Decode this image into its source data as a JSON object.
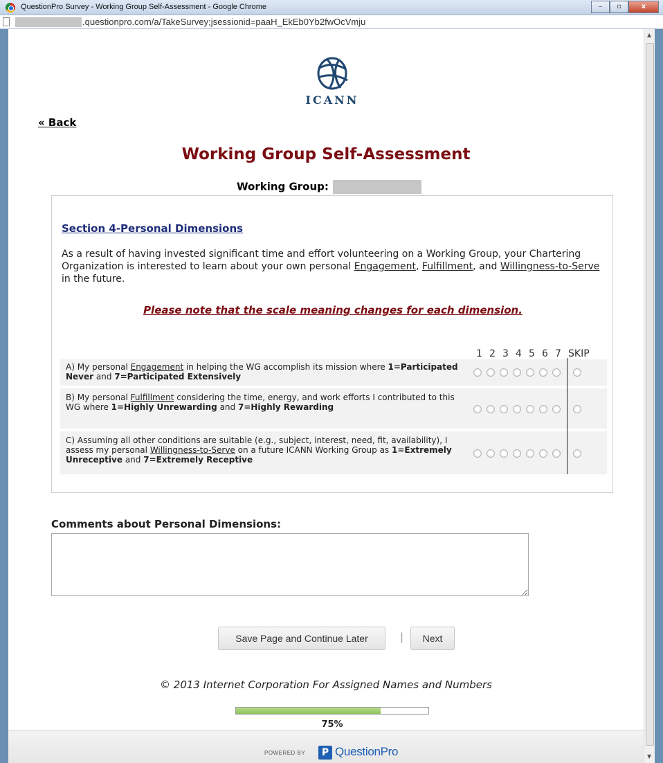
{
  "window": {
    "title": "QuestionPro Survey - Working Group Self-Assessment - Google Chrome",
    "url": ".questionpro.com/a/TakeSurvey;jsessionid=paaH_EkEb0Yb2fwOcVmju",
    "controls": {
      "minimize": "–",
      "maximize": "▫",
      "close": "x"
    }
  },
  "header": {
    "logo_text": "ICANN",
    "back_label": "« Back",
    "page_title": "Working Group Self-Assessment",
    "working_group_label": "Working Group:"
  },
  "section": {
    "title": "Section 4-Personal Dimensions",
    "intro": {
      "part1": "As a result of having invested significant time and effort volunteering on a Working Group, your Chartering Organization is interested to learn about your own personal ",
      "term1": "Engagement",
      "sep1": ", ",
      "term2": "Fulfillment",
      "sep2": ", and ",
      "term3": "Willingness-to-Serve",
      "part2": " in the future."
    },
    "note": "Please note that the scale meaning changes for each dimension."
  },
  "matrix": {
    "scale": [
      "1",
      "2",
      "3",
      "4",
      "5",
      "6",
      "7"
    ],
    "skip_label": "SKIP",
    "questions": [
      {
        "pre": "A) My personal ",
        "term": "Engagement",
        "mid": " in helping the WG accomplish its mission where ",
        "low": "1=Participated Never",
        "and": " and ",
        "high": "7=Participated Extensively"
      },
      {
        "pre": "B) My personal ",
        "term": "Fulfillment",
        "mid": " considering the time, energy, and work efforts I contributed to this WG where ",
        "low": "1=Highly Unrewarding",
        "and": " and ",
        "high": "7=Highly Rewarding"
      },
      {
        "pre": "C) Assuming all other conditions are suitable (e.g., subject, interest, need, fit, availability), I assess my personal ",
        "term": "Willingness-to-Serve",
        "mid": " on a future ICANN Working Group as ",
        "low": "1=Extremely Unreceptive",
        "and": " and ",
        "high": "7=Extremely Receptive"
      }
    ]
  },
  "comments": {
    "label": "Comments about Personal Dimensions:",
    "value": ""
  },
  "actions": {
    "save_label": "Save Page and Continue Later",
    "separator": "|",
    "next_label": "Next"
  },
  "footer": {
    "copyright": "© 2013 Internet Corporation For Assigned Names and Numbers",
    "progress_percent": 75,
    "progress_label": "75%",
    "powered_by": "POWERED BY",
    "brand_icon": "P",
    "brand_name": "QuestionPro"
  }
}
